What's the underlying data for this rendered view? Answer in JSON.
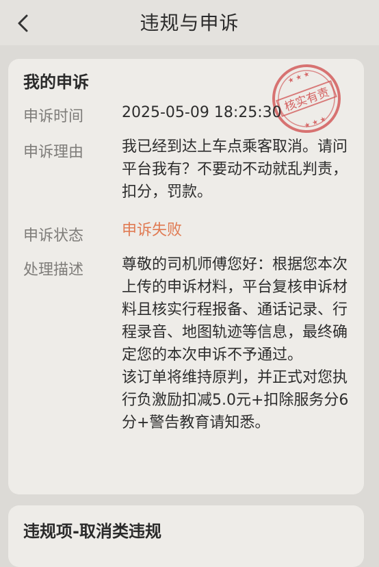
{
  "header": {
    "title": "违规与申诉"
  },
  "appeal": {
    "section_title": "我的申诉",
    "stamp_text": "核实有责",
    "time_label": "申诉时间",
    "time_value": "2025-05-09 18:25:30",
    "reason_label": "申诉理由",
    "reason_value": "我已经到达上车点乘客取消。请问平台我有？不要动不动就乱判责，扣分，罚款。",
    "status_label": "申诉状态",
    "status_value": "申诉失败",
    "desc_label": "处理描述",
    "desc_paragraph1": "尊敬的司机师傅您好：根据您本次上传的申诉材料，平台复核申诉材料且核实行程报备、通话记录、行程录音、地图轨迹等信息，最终确定您的本次申诉不予通过。",
    "desc_paragraph2": "该订单将维持原判，并正式对您执行负激励扣减5.0元+扣除服务分6分+警告教育请知悉。"
  },
  "violation": {
    "section_title": "违规项-取消类违规"
  },
  "colors": {
    "background": "#dcdad6",
    "card": "#eeece8",
    "status_failed": "#e07a52",
    "stamp": "#cf4a4a"
  }
}
